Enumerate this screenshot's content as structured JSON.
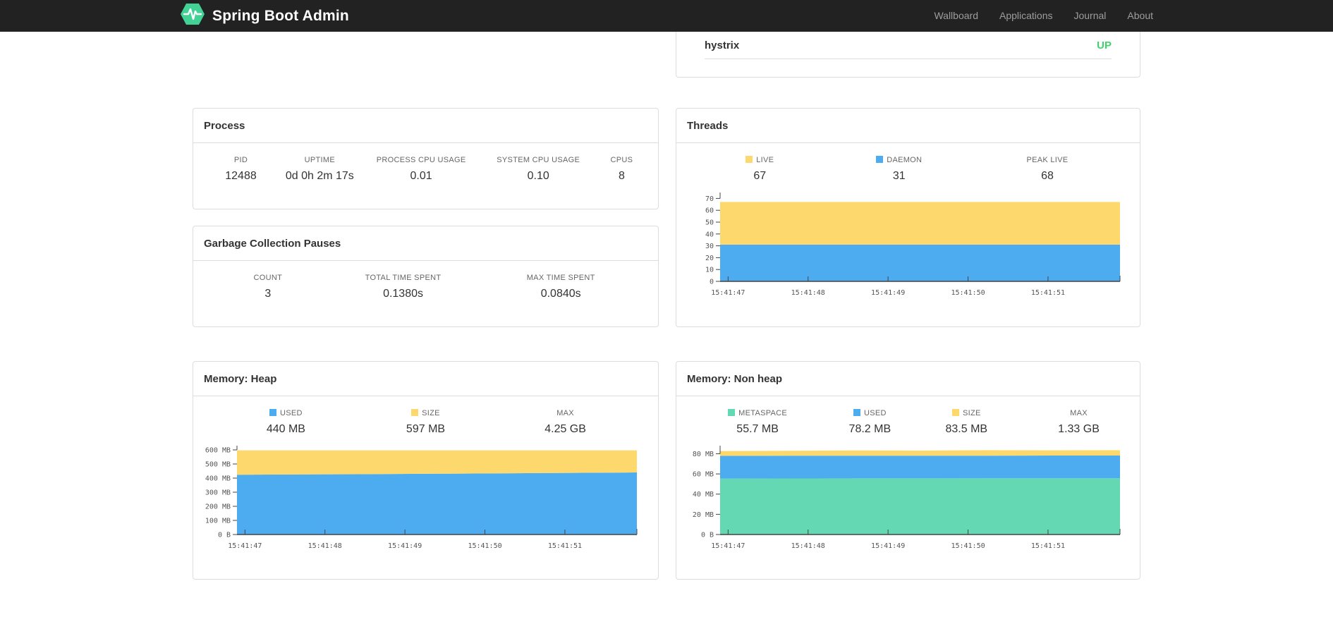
{
  "navbar": {
    "brand": "Spring Boot Admin",
    "links": [
      "Wallboard",
      "Applications",
      "Journal",
      "About"
    ],
    "colors": {
      "bg": "#222222",
      "link": "#9d9d9d",
      "brand_text": "#ffffff",
      "logo": "#42d296"
    }
  },
  "application_row": {
    "name": "hystrix",
    "status": "UP",
    "status_color": "#43d16b"
  },
  "cards": {
    "process": {
      "title": "Process",
      "metrics": [
        {
          "label": "PID",
          "value": "12488"
        },
        {
          "label": "UPTIME",
          "value": "0d 0h 2m 17s"
        },
        {
          "label": "PROCESS CPU USAGE",
          "value": "0.01"
        },
        {
          "label": "SYSTEM CPU USAGE",
          "value": "0.10"
        },
        {
          "label": "CPUS",
          "value": "8"
        }
      ]
    },
    "gc": {
      "title": "Garbage Collection Pauses",
      "metrics": [
        {
          "label": "COUNT",
          "value": "3"
        },
        {
          "label": "TOTAL TIME SPENT",
          "value": "0.1380s"
        },
        {
          "label": "MAX TIME SPENT",
          "value": "0.0840s"
        }
      ]
    },
    "threads": {
      "title": "Threads",
      "metrics": [
        {
          "label": "LIVE",
          "value": "67",
          "color": "#fdd96d"
        },
        {
          "label": "DAEMON",
          "value": "31",
          "color": "#4dacef"
        },
        {
          "label": "PEAK LIVE",
          "value": "68"
        }
      ]
    },
    "heap": {
      "title": "Memory: Heap",
      "metrics": [
        {
          "label": "USED",
          "value": "440 MB",
          "color": "#4dacef"
        },
        {
          "label": "SIZE",
          "value": "597 MB",
          "color": "#fdd96d"
        },
        {
          "label": "MAX",
          "value": "4.25 GB"
        }
      ]
    },
    "nonheap": {
      "title": "Memory: Non heap",
      "metrics": [
        {
          "label": "METASPACE",
          "value": "55.7 MB",
          "color": "#63d8b2"
        },
        {
          "label": "USED",
          "value": "78.2 MB",
          "color": "#4dacef"
        },
        {
          "label": "SIZE",
          "value": "83.5 MB",
          "color": "#fdd96d"
        },
        {
          "label": "MAX",
          "value": "1.33 GB"
        }
      ]
    }
  },
  "chart_data": [
    {
      "id": "threads",
      "type": "area",
      "stacked": true,
      "values_are_absolute_stack_tops": true,
      "title": "Threads",
      "x_ticks": [
        "15:41:47",
        "15:41:48",
        "15:41:49",
        "15:41:50",
        "15:41:51"
      ],
      "x_tick_fractions": [
        0.02,
        0.22,
        0.42,
        0.62,
        0.82
      ],
      "ymax": 75,
      "y_ticks": [
        {
          "v": 0,
          "label": "0"
        },
        {
          "v": 10,
          "label": "10"
        },
        {
          "v": 20,
          "label": "20"
        },
        {
          "v": 30,
          "label": "30"
        },
        {
          "v": 40,
          "label": "40"
        },
        {
          "v": 50,
          "label": "50"
        },
        {
          "v": 60,
          "label": "60"
        },
        {
          "v": 70,
          "label": "70"
        }
      ],
      "series": [
        {
          "name": "DAEMON",
          "color": "#4dacef",
          "values": [
            31,
            31,
            31,
            31,
            31,
            31,
            31
          ]
        },
        {
          "name": "LIVE",
          "color": "#fdd96d",
          "values": [
            67,
            67,
            67,
            67,
            67,
            67,
            67
          ]
        }
      ]
    },
    {
      "id": "heap",
      "type": "area",
      "stacked": true,
      "values_are_absolute_stack_tops": true,
      "title": "Memory: Heap (MB)",
      "x_ticks": [
        "15:41:47",
        "15:41:48",
        "15:41:49",
        "15:41:50",
        "15:41:51"
      ],
      "x_tick_fractions": [
        0.02,
        0.22,
        0.42,
        0.62,
        0.82
      ],
      "ymax": 630,
      "y_ticks": [
        {
          "v": 0,
          "label": "0 B"
        },
        {
          "v": 100,
          "label": "100 MB"
        },
        {
          "v": 200,
          "label": "200 MB"
        },
        {
          "v": 300,
          "label": "300 MB"
        },
        {
          "v": 400,
          "label": "400 MB"
        },
        {
          "v": 500,
          "label": "500 MB"
        },
        {
          "v": 600,
          "label": "600 MB"
        }
      ],
      "series": [
        {
          "name": "USED",
          "color": "#4dacef",
          "values": [
            424,
            426,
            428,
            431,
            434,
            437,
            440
          ]
        },
        {
          "name": "SIZE",
          "color": "#fdd96d",
          "values": [
            597,
            597,
            597,
            597,
            597,
            597,
            597
          ]
        }
      ]
    },
    {
      "id": "nonheap",
      "type": "area",
      "stacked": true,
      "values_are_absolute_stack_tops": true,
      "title": "Memory: Non heap (MB)",
      "x_ticks": [
        "15:41:47",
        "15:41:48",
        "15:41:49",
        "15:41:50",
        "15:41:51"
      ],
      "x_tick_fractions": [
        0.02,
        0.22,
        0.42,
        0.62,
        0.82
      ],
      "ymax": 88,
      "y_ticks": [
        {
          "v": 0,
          "label": "0 B"
        },
        {
          "v": 20,
          "label": "20 MB"
        },
        {
          "v": 40,
          "label": "40 MB"
        },
        {
          "v": 60,
          "label": "60 MB"
        },
        {
          "v": 80,
          "label": "80 MB"
        }
      ],
      "series": [
        {
          "name": "METASPACE",
          "color": "#63d8b2",
          "values": [
            55.4,
            55.5,
            55.6,
            55.6,
            55.7,
            55.7,
            55.7
          ]
        },
        {
          "name": "USED",
          "color": "#4dacef",
          "values": [
            77.9,
            78.0,
            78.0,
            78.1,
            78.1,
            78.2,
            78.2
          ]
        },
        {
          "name": "SIZE",
          "color": "#fdd96d",
          "values": [
            82.7,
            82.9,
            83.3,
            83.1,
            83.5,
            83.4,
            83.5
          ]
        }
      ]
    }
  ]
}
